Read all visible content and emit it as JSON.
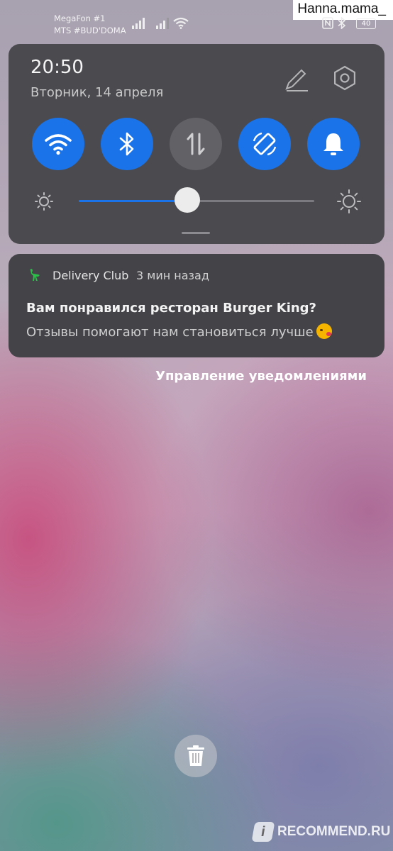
{
  "status_bar": {
    "carrier_1": "MegaFon #1",
    "carrier_2": "MTS #BUD'DOMA",
    "battery_level": "40",
    "icons": [
      "signal-icon",
      "signal-icon",
      "wifi-icon",
      "nfc-icon",
      "bluetooth-icon",
      "battery-icon"
    ]
  },
  "watermark_top": "Hanna.mama_",
  "quick_settings": {
    "time": "20:50",
    "date": "Вторник, 14 апреля",
    "toggles": [
      {
        "name": "wifi",
        "icon": "wifi-icon",
        "on": true
      },
      {
        "name": "bluetooth",
        "icon": "bluetooth-icon",
        "on": true
      },
      {
        "name": "mobile-data",
        "icon": "data-arrows-icon",
        "on": false
      },
      {
        "name": "auto-rotate",
        "icon": "rotate-icon",
        "on": true
      },
      {
        "name": "sound",
        "icon": "bell-icon",
        "on": true
      }
    ],
    "brightness_level": 0.46,
    "accent_color": "#1a73e8"
  },
  "notification": {
    "app_name": "Delivery Club",
    "time": "3 мин назад",
    "title": "Вам понравился ресторан Burger King?",
    "body": "Отзывы помогают нам становиться лучше",
    "app_icon": "ostrich-icon",
    "app_color": "#2dbe4a"
  },
  "manage_label": "Управление уведомлениями",
  "watermark_bottom": {
    "icon_letter": "i",
    "text": "RECOMMEND.RU"
  }
}
